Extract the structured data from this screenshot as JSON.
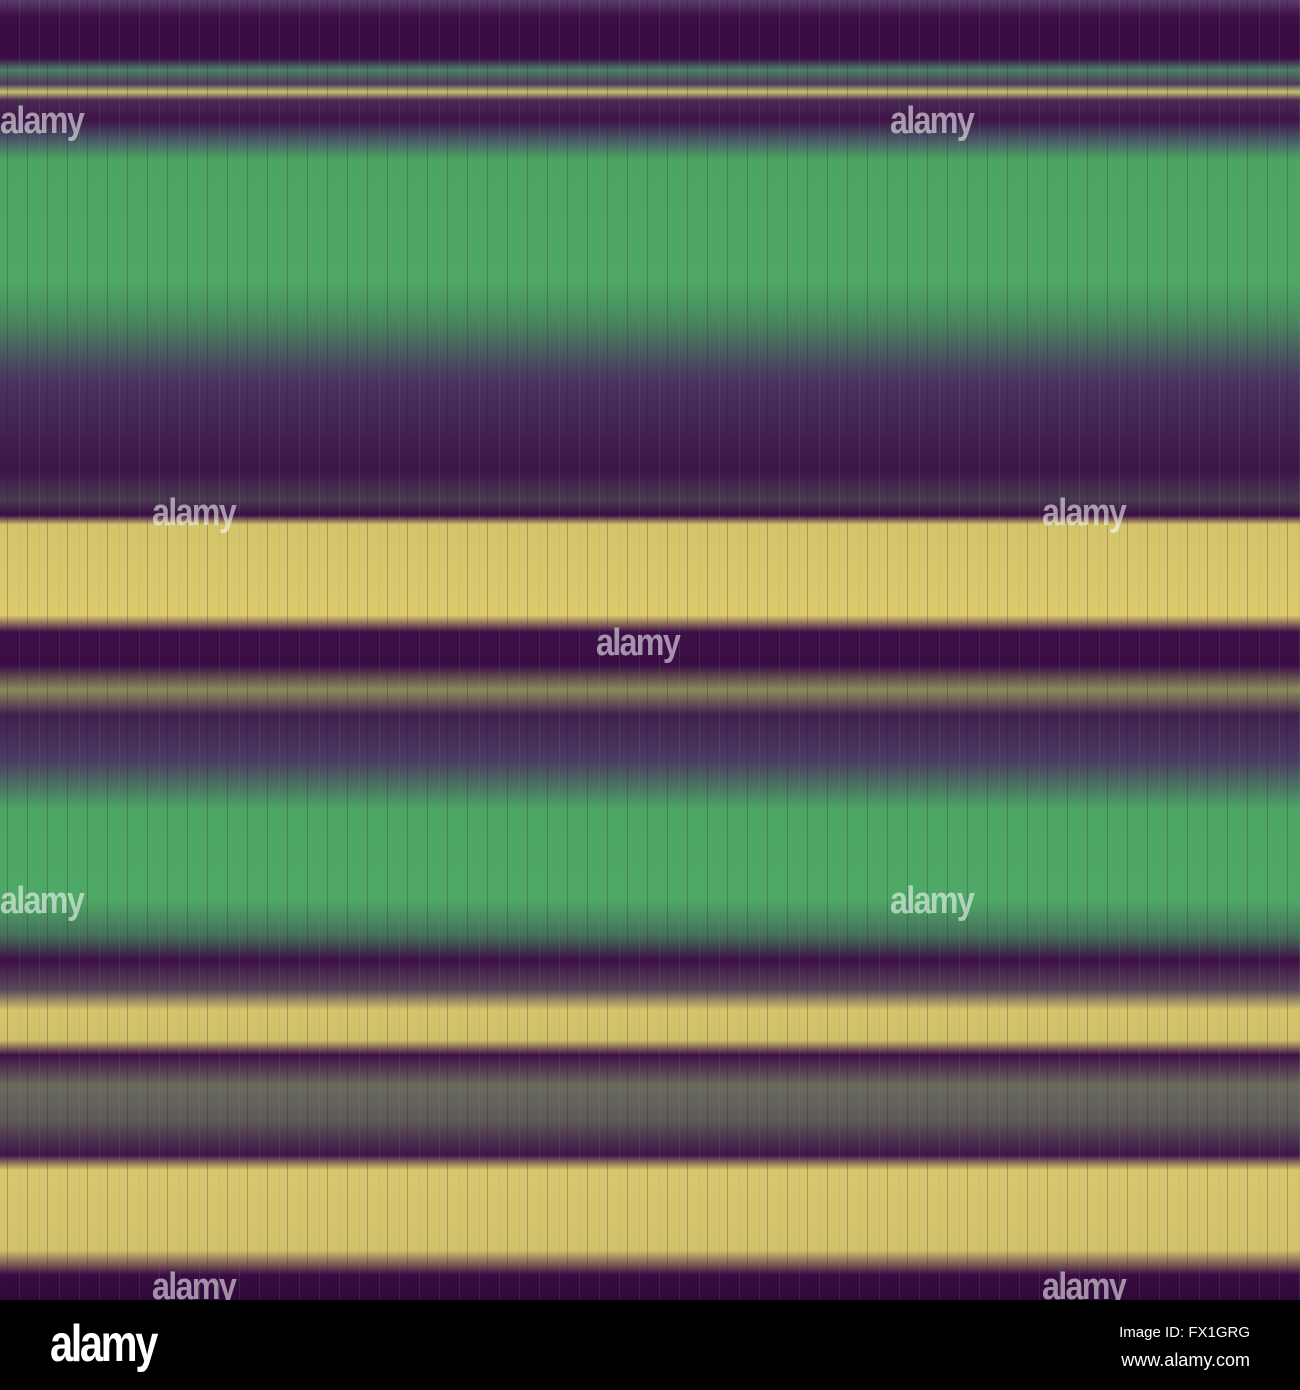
{
  "watermark": {
    "text": "alamy"
  },
  "footer": {
    "logo": "alamy",
    "image_id": "Image ID: FX1GRG",
    "url": "www.alamy.com"
  },
  "colors": {
    "purple": "#3b0c45",
    "green": "#4ca662",
    "yellow": "#d8c66c",
    "footer": "#000000"
  }
}
